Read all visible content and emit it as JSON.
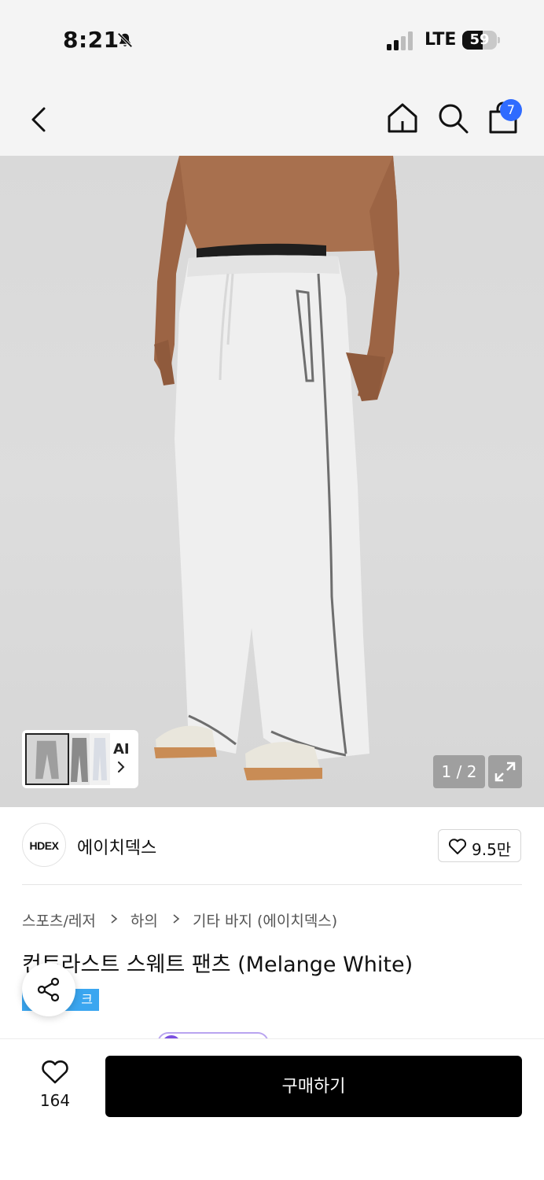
{
  "status_bar": {
    "time": "8:21",
    "network": "LTE",
    "battery_percent": 59,
    "battery_text": "59",
    "icons": [
      "bell-slash-icon",
      "signal-icon"
    ]
  },
  "header": {
    "icons": [
      "chevron-left-icon",
      "home-icon",
      "search-icon",
      "shopping-bag-icon"
    ],
    "cart_count": "7",
    "accent_color": "#2f6bff"
  },
  "gallery": {
    "ai_label": "AI",
    "page_indicator": "1 / 2",
    "icons": [
      "expand-icon",
      "chevron-right-icon"
    ]
  },
  "brand": {
    "logo_text": "HDEX",
    "name": "에이치덱스",
    "likes": "9.5만"
  },
  "breadcrumb": [
    "스포츠/레저",
    "하의",
    "기타 바지 (에이치덱스)"
  ],
  "product": {
    "title": "컨트라스트 스웨트 팬츠 (Melange White)",
    "tag": "크",
    "tag_color": "#3aa6f0"
  },
  "bottom_bar": {
    "wish_count": "164",
    "buy_label": "구매하기"
  }
}
